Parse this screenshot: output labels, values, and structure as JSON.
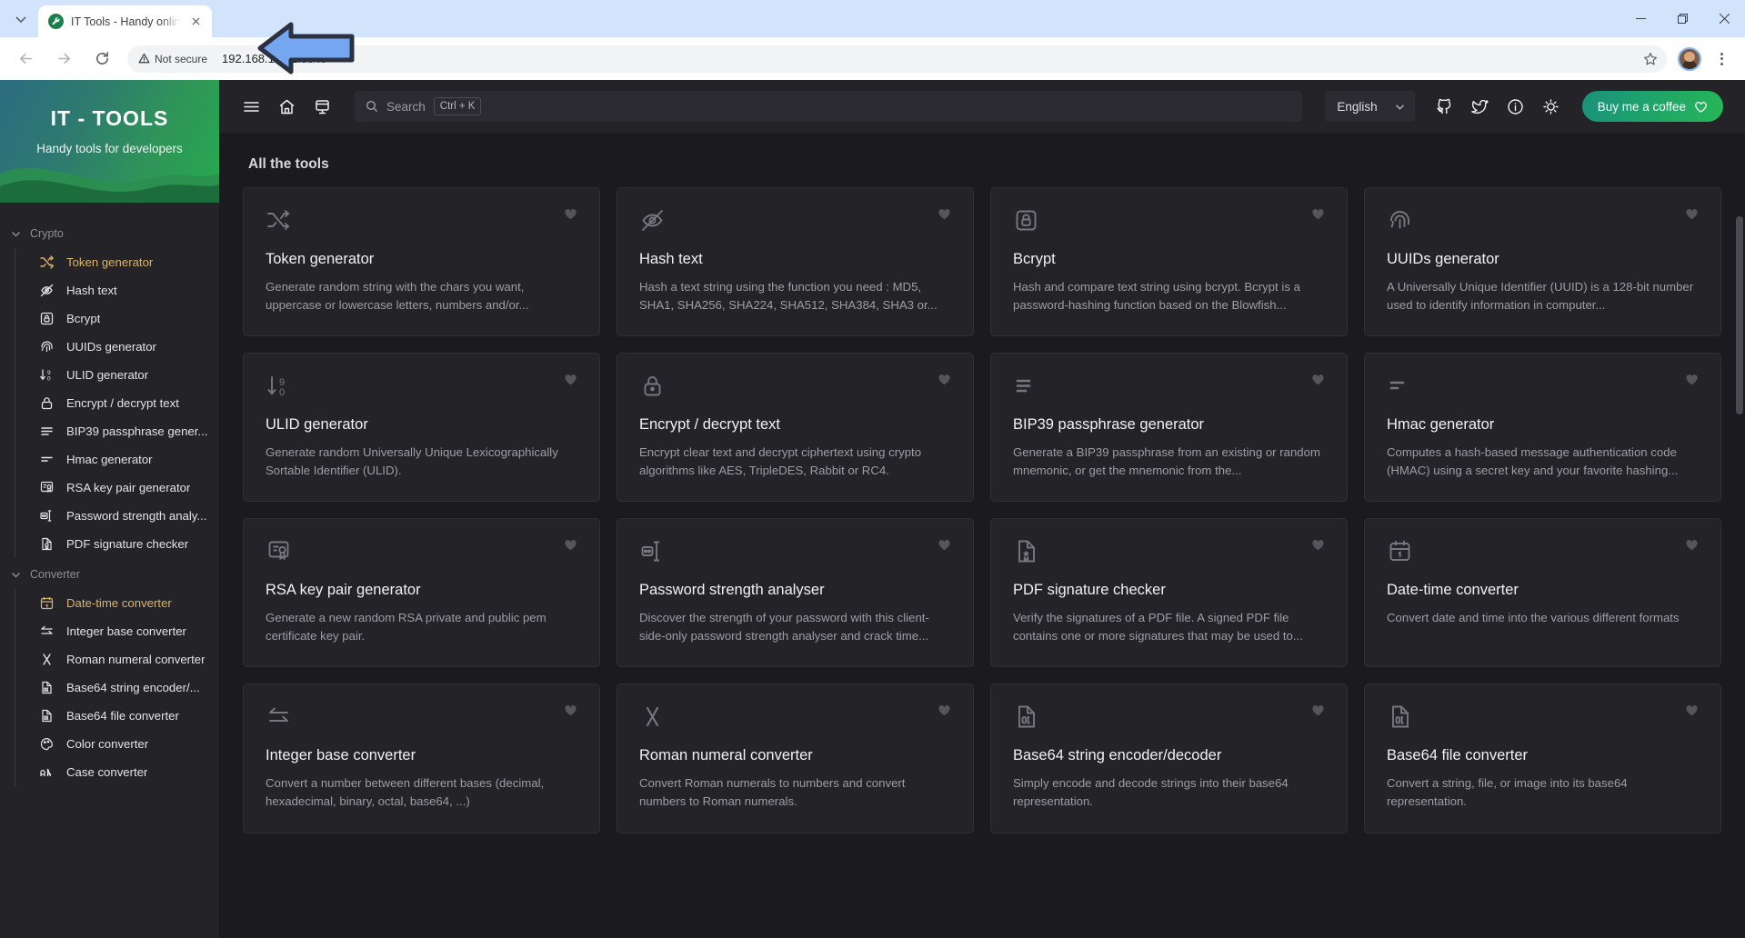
{
  "browser": {
    "tab": {
      "title": "IT Tools - Handy onlin",
      "favicon_name": "it-tools-favicon"
    },
    "omnibox": {
      "security_label": "Not secure",
      "url": "192.168.1.152:5545"
    },
    "window_controls": {
      "minimize": "—",
      "maximize": "❐",
      "close": "✕"
    }
  },
  "sidebar": {
    "title": "IT - TOOLS",
    "subtitle": "Handy tools for developers",
    "groups": [
      {
        "name": "Crypto",
        "items": [
          {
            "label": "Token generator",
            "icon": "shuffle-icon",
            "highlight": true
          },
          {
            "label": "Hash text",
            "icon": "eye-off-icon",
            "highlight": false
          },
          {
            "label": "Bcrypt",
            "icon": "lock-square-icon",
            "highlight": false
          },
          {
            "label": "UUIDs generator",
            "icon": "fingerprint-icon",
            "highlight": false
          },
          {
            "label": "ULID generator",
            "icon": "arrow-down-90-icon",
            "highlight": false
          },
          {
            "label": "Encrypt / decrypt text",
            "icon": "padlock-icon",
            "highlight": false
          },
          {
            "label": "BIP39 passphrase gener...",
            "icon": "lines-icon",
            "highlight": false
          },
          {
            "label": "Hmac generator",
            "icon": "two-lines-icon",
            "highlight": false
          },
          {
            "label": "RSA key pair generator",
            "icon": "certificate-icon",
            "highlight": false
          },
          {
            "label": "Password strength analy...",
            "icon": "password-meter-icon",
            "highlight": false
          },
          {
            "label": "PDF signature checker",
            "icon": "pdf-signature-icon",
            "highlight": false
          }
        ]
      },
      {
        "name": "Converter",
        "items": [
          {
            "label": "Date-time converter",
            "icon": "calendar-icon",
            "highlight": true
          },
          {
            "label": "Integer base converter",
            "icon": "arrows-exchange-icon",
            "highlight": false
          },
          {
            "label": "Roman numeral converter",
            "icon": "roman-x-icon",
            "highlight": false
          },
          {
            "label": "Base64 string encoder/...",
            "icon": "file-binary-icon",
            "highlight": false
          },
          {
            "label": "Base64 file converter",
            "icon": "file-binary-icon",
            "highlight": false
          },
          {
            "label": "Color converter",
            "icon": "palette-icon",
            "highlight": false
          },
          {
            "label": "Case converter",
            "icon": "case-icon",
            "highlight": false
          }
        ]
      }
    ]
  },
  "topbar": {
    "menu_icon": "hamburger-icon",
    "home_icon": "home-icon",
    "apps_icon": "app-window-icon",
    "search_placeholder": "Search",
    "search_shortcut": "Ctrl + K",
    "language": "English",
    "github_icon": "github-icon",
    "twitter_icon": "twitter-icon",
    "info_icon": "info-circle-icon",
    "theme_icon": "sun-icon",
    "coffee_label": "Buy me a coffee"
  },
  "main": {
    "section_title": "All the tools",
    "tools": [
      {
        "title": "Token generator",
        "desc": "Generate random string with the chars you want, uppercase or lowercase letters, numbers and/or...",
        "icon": "shuffle-icon"
      },
      {
        "title": "Hash text",
        "desc": "Hash a text string using the function you need : MD5, SHA1, SHA256, SHA224, SHA512, SHA384, SHA3 or...",
        "icon": "eye-off-icon"
      },
      {
        "title": "Bcrypt",
        "desc": "Hash and compare text string using bcrypt. Bcrypt is a password-hashing function based on the Blowfish...",
        "icon": "lock-square-icon"
      },
      {
        "title": "UUIDs generator",
        "desc": "A Universally Unique Identifier (UUID) is a 128-bit number used to identify information in computer...",
        "icon": "fingerprint-icon"
      },
      {
        "title": "ULID generator",
        "desc": "Generate random Universally Unique Lexicographically Sortable Identifier (ULID).",
        "icon": "arrow-down-90-icon"
      },
      {
        "title": "Encrypt / decrypt text",
        "desc": "Encrypt clear text and decrypt ciphertext using crypto algorithms like AES, TripleDES, Rabbit or RC4.",
        "icon": "padlock-icon"
      },
      {
        "title": "BIP39 passphrase generator",
        "desc": "Generate a BIP39 passphrase from an existing or random mnemonic, or get the mnemonic from the...",
        "icon": "lines-icon"
      },
      {
        "title": "Hmac generator",
        "desc": "Computes a hash-based message authentication code (HMAC) using a secret key and your favorite hashing...",
        "icon": "two-lines-icon"
      },
      {
        "title": "RSA key pair generator",
        "desc": "Generate a new random RSA private and public pem certificate key pair.",
        "icon": "certificate-icon"
      },
      {
        "title": "Password strength analyser",
        "desc": "Discover the strength of your password with this client-side-only password strength analyser and crack time...",
        "icon": "password-meter-icon"
      },
      {
        "title": "PDF signature checker",
        "desc": "Verify the signatures of a PDF file. A signed PDF file contains one or more signatures that may be used to...",
        "icon": "pdf-signature-icon"
      },
      {
        "title": "Date-time converter",
        "desc": "Convert date and time into the various different formats",
        "icon": "calendar-icon"
      },
      {
        "title": "Integer base converter",
        "desc": "Convert a number between different bases (decimal, hexadecimal, binary, octal, base64, ...)",
        "icon": "arrows-exchange-icon"
      },
      {
        "title": "Roman numeral converter",
        "desc": "Convert Roman numerals to numbers and convert numbers to Roman numerals.",
        "icon": "roman-x-icon"
      },
      {
        "title": "Base64 string encoder/decoder",
        "desc": "Simply encode and decode strings into their base64 representation.",
        "icon": "file-binary-icon"
      },
      {
        "title": "Base64 file converter",
        "desc": "Convert a string, file, or image into its base64 representation.",
        "icon": "file-binary-icon"
      }
    ]
  },
  "colors": {
    "accent_green": "#26b657",
    "sidebar_bg": "#232328",
    "page_bg": "#1b1b1f",
    "highlight_text": "#d9b36c",
    "annotation_arrow": "#74a7f0"
  }
}
